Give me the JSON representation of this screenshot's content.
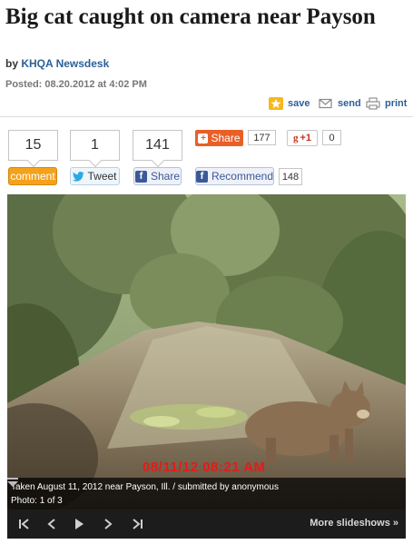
{
  "article": {
    "headline": "Big cat caught on camera near Payson",
    "byline_prefix": "by ",
    "author": "KHQA Newsdesk",
    "posted": "Posted: 08.20.2012 at 4:02 PM"
  },
  "tools": {
    "save": "save",
    "send": "send",
    "print": "print"
  },
  "social": {
    "comment_count": "15",
    "comment_label": "comment",
    "tweet_count": "1",
    "tweet_label": "Tweet",
    "fb_share_count": "141",
    "fb_share_label": "Share",
    "share_label": "Share",
    "share_count": "177",
    "gplus_label": "+1",
    "gplus_count": "0",
    "recommend_label": "Recommend",
    "recommend_count": "148"
  },
  "slideshow": {
    "timestamp_overlay": "08/11/12  08:21 AM",
    "caption": "Taken August 11, 2012 near Payson, Ill.  / submitted by anonymous",
    "counter": "Photo: 1 of 3",
    "more_label": "More slideshows »"
  },
  "icons": {
    "save": "star-icon",
    "send": "envelope-icon",
    "print": "printer-icon",
    "first": "skip-first-icon",
    "prev": "chevron-left-icon",
    "play": "play-icon",
    "next": "chevron-right-icon",
    "last": "skip-last-icon"
  },
  "colors": {
    "link": "#2b5f97",
    "comment_button": "#f4a21c",
    "share_button": "#e95f28",
    "facebook": "#3b5998",
    "timestamp": "#e81919"
  }
}
